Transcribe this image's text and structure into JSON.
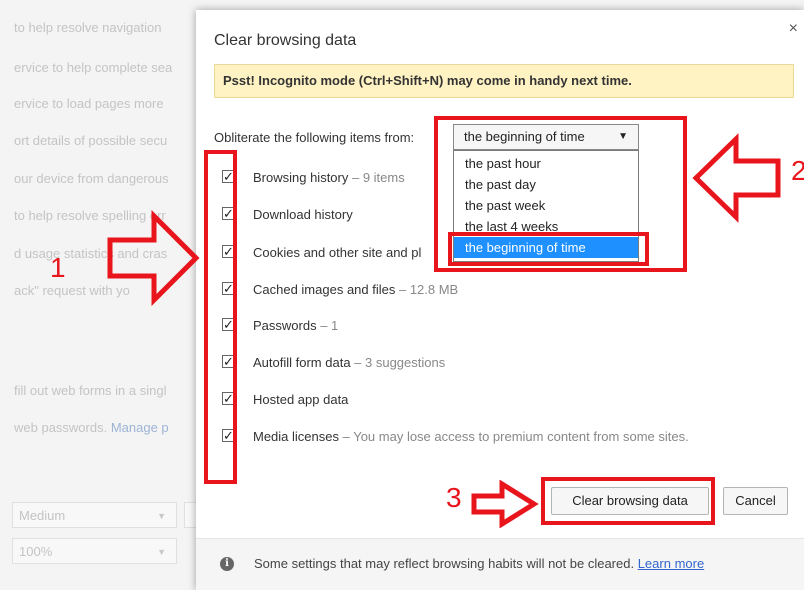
{
  "background": {
    "lines": [
      "to help resolve navigation",
      "ervice to help complete sea",
      "ervice to load pages more",
      "ort details of possible secu",
      "our device from dangerous",
      "to help resolve spelling err",
      "d usage statistics and cras",
      "ack\" request with yo",
      "fill out web forms in a singl"
    ],
    "passwords_prefix": "web passwords.",
    "passwords_link": "Manage p",
    "font_size_value": "Medium",
    "zoom_value": "100%"
  },
  "dialog": {
    "title": "Clear browsing data",
    "close_glyph": "×",
    "incognito_banner": "Psst! Incognito mode (Ctrl+Shift+N) may come in handy next time.",
    "obliterate_label": "Obliterate the following items from:",
    "time_range": {
      "selected": "the beginning of time",
      "options": [
        "the past hour",
        "the past day",
        "the past week",
        "the last 4 weeks",
        "the beginning of time"
      ]
    },
    "items": [
      {
        "label": "Browsing history",
        "detail": " – 9 items",
        "checked": true
      },
      {
        "label": "Download history",
        "detail": "",
        "checked": true
      },
      {
        "label": "Cookies and other site and pl",
        "detail": "",
        "checked": true
      },
      {
        "label": "Cached images and files",
        "detail": " – 12.8 MB",
        "checked": true
      },
      {
        "label": "Passwords",
        "detail": " – 1",
        "checked": true
      },
      {
        "label": "Autofill form data",
        "detail": " – 3 suggestions",
        "checked": true
      },
      {
        "label": "Hosted app data",
        "detail": "",
        "checked": true
      },
      {
        "label": "Media licenses",
        "detail": " – You may lose access to premium content from some sites.",
        "checked": true
      }
    ],
    "clear_button": "Clear browsing data",
    "cancel_button": "Cancel",
    "footer_text": "Some settings that may reflect browsing habits will not be cleared.",
    "learn_more": "Learn more",
    "info_glyph": "i"
  },
  "annotations": {
    "numbers": [
      "1",
      "2",
      "3"
    ],
    "color": "#e8151d"
  },
  "icons": {
    "checkbox": "checkmark-icon",
    "dropdown": "caret-down-icon",
    "info": "info-icon",
    "close": "close-icon",
    "annotation": "outline-arrow-icon"
  }
}
